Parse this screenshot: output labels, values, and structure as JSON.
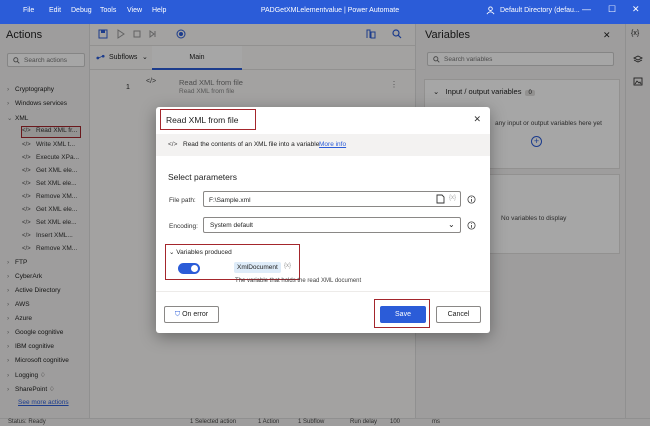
{
  "titlebar": {
    "menus": [
      "File",
      "Edit",
      "Debug",
      "Tools",
      "View",
      "Help"
    ],
    "title": "PADGetXMLelementvalue | Power Automate",
    "directory": "Default Directory (defau..."
  },
  "actions_pane": {
    "title": "Actions",
    "search_placeholder": "Search actions",
    "categories_top": [
      "Cryptography",
      "Windows services"
    ],
    "xml_category": "XML",
    "xml_items": [
      "Read XML fr...",
      "Write XML t...",
      "Execute XPa...",
      "Get XML ele...",
      "Set XML ele...",
      "Remove XM...",
      "Get XML ele...",
      "Set XML ele...",
      "Insert XML...",
      "Remove XM..."
    ],
    "categories_bottom": [
      "FTP",
      "CyberArk",
      "Active Directory",
      "AWS",
      "Azure",
      "Google cognitive",
      "IBM cognitive",
      "Microsoft cognitive",
      "Logging",
      "SharePoint"
    ],
    "see_more": "See more actions"
  },
  "designer": {
    "subflows_label": "Subflows",
    "main_tab": "Main",
    "step_number": "1",
    "step_title": "Read XML from file",
    "step_subtitle": "Read XML from file"
  },
  "variables_pane": {
    "title": "Variables",
    "search_placeholder": "Search variables",
    "io_title": "Input / output variables",
    "io_count": "0",
    "io_empty_text": "any input or output variables here yet",
    "flow_title": "les",
    "flow_count": "0",
    "flow_empty_text": "No variables to display"
  },
  "statusbar": {
    "status": "Status: Ready",
    "selected": "1 Selected action",
    "actions": "1 Action",
    "subflows": "1 Subflow",
    "run_delay_label": "Run delay",
    "run_delay_value": "100",
    "unit": "ms"
  },
  "dialog": {
    "title": "Read XML from file",
    "description": "Read the contents of an XML file into a variable",
    "more_info": "More info",
    "section_title": "Select parameters",
    "file_path_label": "File path:",
    "file_path_value": "F:\\Sample.xml",
    "encoding_label": "Encoding:",
    "encoding_value": "System default",
    "variables_produced_label": "Variables produced",
    "variable_name": "XmlDocument",
    "variable_desc": "The variable that holds the read XML document",
    "on_error_label": "On error",
    "save_label": "Save",
    "cancel_label": "Cancel"
  },
  "colors": {
    "accent": "#2b5cd8",
    "highlight_border": "#a4262c"
  }
}
